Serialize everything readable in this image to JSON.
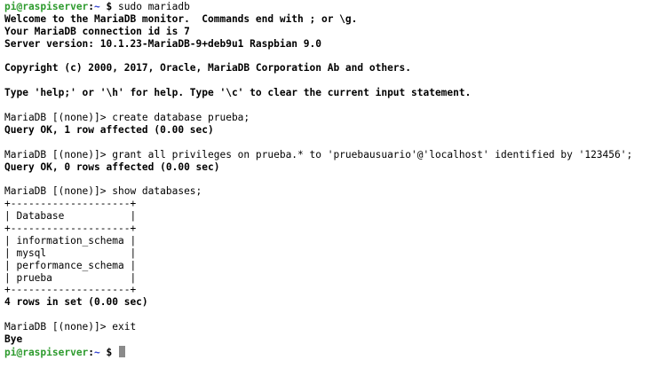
{
  "terminal": {
    "colors": {
      "background": "#ffffff",
      "text": "#000000",
      "prompt_user": "#2e9b2e",
      "prompt_dir": "#2f3fd0",
      "cursor": "#8a8a8a"
    },
    "prompt": {
      "user_host": "pi@raspiserver",
      "separator": ":",
      "dir": "~",
      "sign": " $ "
    },
    "first_command": "sudo mariadb",
    "lines": [
      {
        "text": "Welcome to the MariaDB monitor.  Commands end with ; or \\g.",
        "bold": true
      },
      {
        "text": "Your MariaDB connection id is 7",
        "bold": true
      },
      {
        "text": "Server version: 10.1.23-MariaDB-9+deb9u1 Raspbian 9.0",
        "bold": true
      },
      {
        "text": "",
        "bold": false
      },
      {
        "text": "Copyright (c) 2000, 2017, Oracle, MariaDB Corporation Ab and others.",
        "bold": true
      },
      {
        "text": "",
        "bold": false
      },
      {
        "text": "Type 'help;' or '\\h' for help. Type '\\c' to clear the current input statement.",
        "bold": true
      },
      {
        "text": "",
        "bold": false
      },
      {
        "text": "MariaDB [(none)]> create database prueba;",
        "bold": false
      },
      {
        "text": "Query OK, 1 row affected (0.00 sec)",
        "bold": true
      },
      {
        "text": "",
        "bold": false
      },
      {
        "text": "MariaDB [(none)]> grant all privileges on prueba.* to 'pruebausuario'@'localhost' identified by '123456';",
        "bold": false
      },
      {
        "text": "Query OK, 0 rows affected (0.00 sec)",
        "bold": true
      },
      {
        "text": "",
        "bold": false
      },
      {
        "text": "MariaDB [(none)]> show databases;",
        "bold": false
      },
      {
        "text": "+--------------------+",
        "bold": false
      },
      {
        "text": "| Database           |",
        "bold": false
      },
      {
        "text": "+--------------------+",
        "bold": false
      },
      {
        "text": "| information_schema |",
        "bold": false
      },
      {
        "text": "| mysql              |",
        "bold": false
      },
      {
        "text": "| performance_schema |",
        "bold": false
      },
      {
        "text": "| prueba             |",
        "bold": false
      },
      {
        "text": "+--------------------+",
        "bold": false
      },
      {
        "text": "4 rows in set (0.00 sec)",
        "bold": true
      },
      {
        "text": "",
        "bold": false
      },
      {
        "text": "MariaDB [(none)]> exit",
        "bold": false
      },
      {
        "text": "Bye",
        "bold": true
      }
    ]
  }
}
